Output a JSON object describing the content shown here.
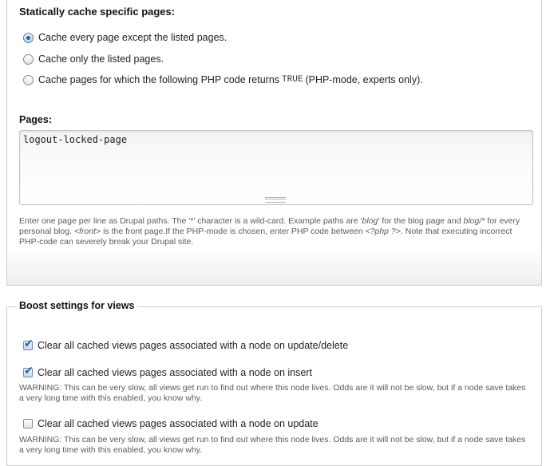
{
  "static_cache": {
    "title": "Statically cache specific pages:",
    "options": [
      {
        "label": "Cache every page except the listed pages.",
        "checked": true
      },
      {
        "label": "Cache only the listed pages.",
        "checked": false
      },
      {
        "label_before": "Cache pages for which the following PHP code returns",
        "code": "TRUE",
        "label_after": "(PHP-mode, experts only).",
        "checked": false
      }
    ],
    "pages_label": "Pages:",
    "pages_value": "logout-locked-page",
    "description": [
      {
        "t": "Enter one page per line as Drupal paths. The '*' character is a wild-card. Example paths are '",
        "em": false
      },
      {
        "t": "blog",
        "em": true
      },
      {
        "t": "' for the blog page and ",
        "em": false
      },
      {
        "t": "blog/*",
        "em": true
      },
      {
        "t": " for every personal blog. ",
        "em": false
      },
      {
        "t": "<front>",
        "em": true
      },
      {
        "t": " is the front page.If the PHP-mode is chosen, enter PHP code between ",
        "em": false
      },
      {
        "t": "<?php ?>",
        "em": true
      },
      {
        "t": ". Note that executing incorrect PHP-code can severely break your Drupal site.",
        "em": false
      }
    ]
  },
  "views": {
    "legend": "Boost settings for views",
    "options": [
      {
        "label": "Clear all cached views pages associated with a node on update/delete",
        "checked": true,
        "warning": ""
      },
      {
        "label": "Clear all cached views pages associated with a node on insert",
        "checked": true,
        "warning": "WARNING: This can be very slow, all views get run to find out where this node lives. Odds are it will not be slow, but if a node save takes a very long time with this enabled, you know why."
      },
      {
        "label": "Clear all cached views pages associated with a node on update",
        "checked": false,
        "warning": "WARNING: This can be very slow, all views get run to find out where this node lives. Odds are it will not be slow, but if a node save takes a very long time with this enabled, you know why."
      }
    ]
  },
  "colors": {
    "accent": "#2e5f94",
    "border": "#cfcfcf",
    "description_text": "#5a5a5a"
  },
  "icons": {
    "checkbox_checked": "checkmark-icon",
    "resize": "resize-grip-icon"
  }
}
